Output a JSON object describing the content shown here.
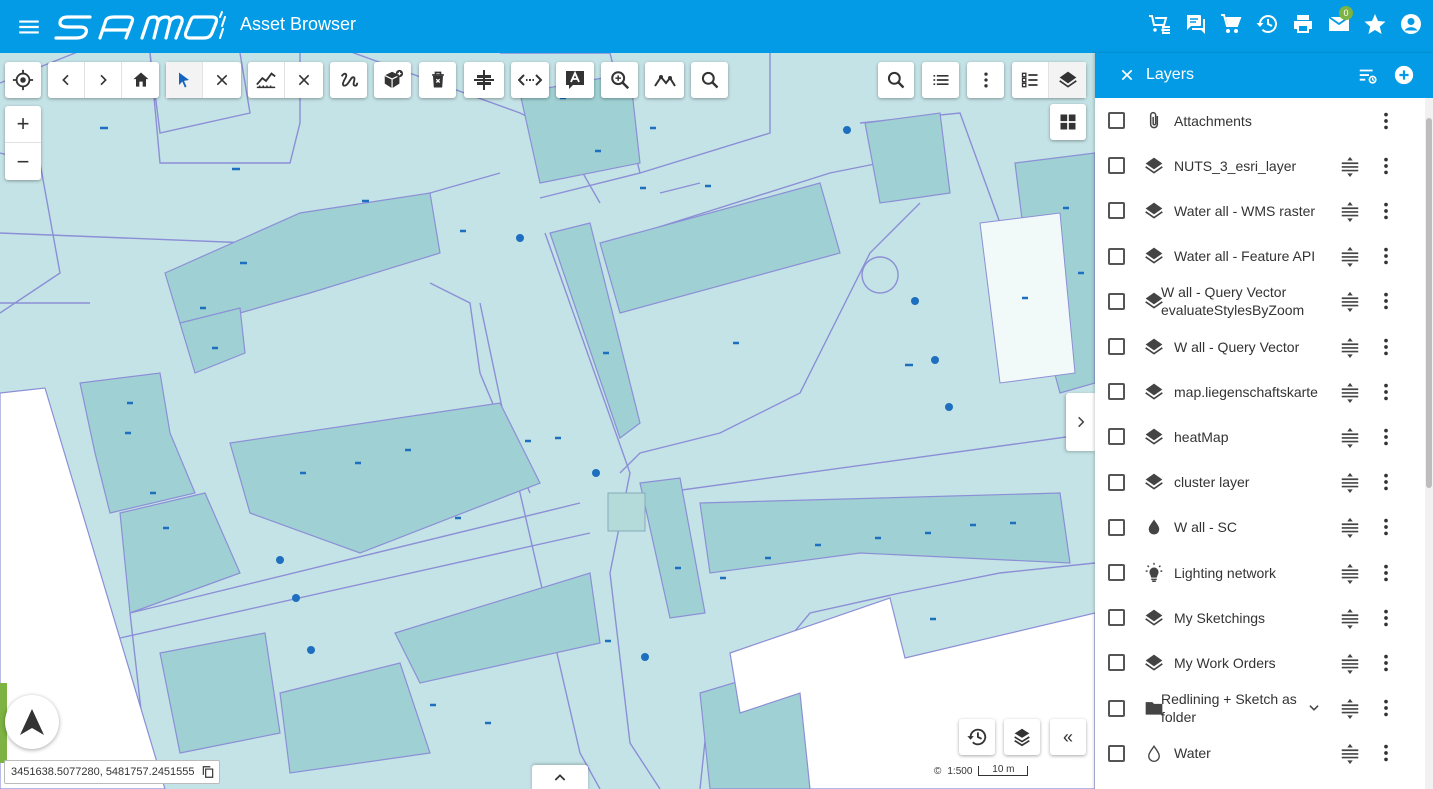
{
  "header": {
    "app_title": "Asset Browser",
    "mail_badge": "0"
  },
  "toolbar": {
    "tools": [
      "locate",
      "back",
      "forward",
      "home",
      "select",
      "clear-selection",
      "measure",
      "clear-measure",
      "sketch",
      "add-object",
      "delete",
      "split",
      "distance",
      "label",
      "zoom-to",
      "profile",
      "search"
    ],
    "right_tools": [
      "search",
      "list",
      "more",
      "legend",
      "layers"
    ]
  },
  "map": {
    "coordinates": "3451638.5077280, 5481757.2451555",
    "scale_text": "1:500",
    "scale_bar_label": "10 m",
    "collapse_label": "«"
  },
  "panel": {
    "title": "Layers",
    "layers": [
      {
        "name": "Attachments",
        "icon": "paperclip-icon",
        "reorder": false,
        "expand": false
      },
      {
        "name": "NUTS_3_esri_layer",
        "icon": "layers-icon",
        "reorder": true,
        "expand": false
      },
      {
        "name": "Water all - WMS raster",
        "icon": "layers-icon",
        "reorder": true,
        "expand": false
      },
      {
        "name": "Water all - Feature API",
        "icon": "layers-icon",
        "reorder": true,
        "expand": false
      },
      {
        "name": "W all - Query Vector evaluateStylesByZoom",
        "icon": "layers-icon",
        "reorder": true,
        "expand": false
      },
      {
        "name": "W all - Query Vector",
        "icon": "layers-icon",
        "reorder": true,
        "expand": false
      },
      {
        "name": "map.liegenschaftskarte",
        "icon": "layers-icon",
        "reorder": true,
        "expand": false
      },
      {
        "name": "heatMap",
        "icon": "layers-icon",
        "reorder": true,
        "expand": false
      },
      {
        "name": "cluster layer",
        "icon": "layers-icon",
        "reorder": true,
        "expand": false
      },
      {
        "name": "W all - SC",
        "icon": "drop-icon",
        "reorder": true,
        "expand": false
      },
      {
        "name": "Lighting network",
        "icon": "bulb-icon",
        "reorder": true,
        "expand": false
      },
      {
        "name": "My Sketchings",
        "icon": "layers-icon",
        "reorder": true,
        "expand": false
      },
      {
        "name": "My Work Orders",
        "icon": "layers-icon",
        "reorder": true,
        "expand": false
      },
      {
        "name": "Redlining + Sketch as folder",
        "icon": "folder-icon",
        "reorder": true,
        "expand": true
      },
      {
        "name": "Water",
        "icon": "drop-outline-icon",
        "reorder": true,
        "expand": false
      }
    ]
  }
}
